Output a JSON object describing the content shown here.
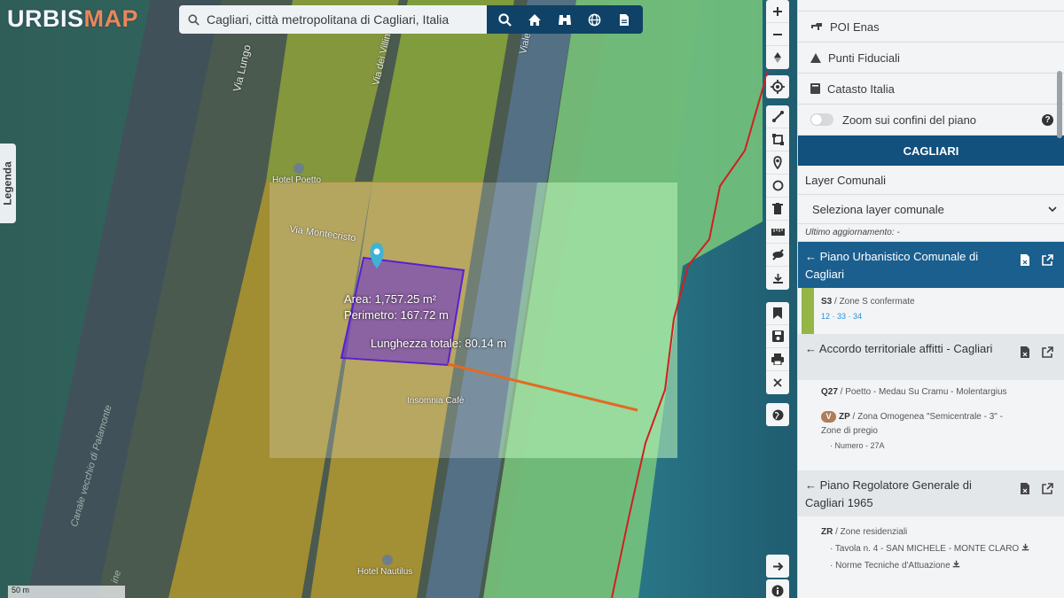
{
  "app": {
    "logo_a": "URBIS",
    "logo_b": "MAP"
  },
  "search": {
    "value": "Cagliari, città metropolitana di Cagliari, Italia",
    "icons": [
      "search-icon",
      "home-icon",
      "binoculars-icon",
      "globe-icon",
      "document-icon"
    ]
  },
  "legend_tab": {
    "label": "Legenda"
  },
  "map": {
    "street_labels": [
      "Via Lungo",
      "Via dei Villini",
      "Viale Po",
      "Via Montecristo"
    ],
    "poi_labels": [
      "Hotel Poetto",
      "Insomnia Cafè",
      "Hotel Nautilus"
    ],
    "faint_labels": [
      "Canale vecchio di Palamonte",
      "ine"
    ],
    "measure": {
      "area": "Area: 1,757.25 m²",
      "perimeter": "Perimetro: 167.72 m",
      "length": "Lunghezza totale: 80.14 m"
    },
    "scale": "50 m",
    "colors": {
      "yellow_zone": "#c9a52a",
      "green_zone": "#8cd383",
      "olive_zone": "#94b63d",
      "blue_zone": "#5d7fa8",
      "measure_poly": "#6a2cd8",
      "measure_line": "#e26a22",
      "coast_line": "#d11f1f"
    }
  },
  "toolbar": {
    "group1": [
      "zoom-in-icon",
      "zoom-out-icon",
      "compass-icon"
    ],
    "group2": [
      "locate-icon"
    ],
    "group3": [
      "measure-line-icon",
      "measure-area-icon",
      "marker-icon",
      "circle-icon",
      "trash-icon",
      "ruler-icon",
      "hide-icon",
      "download-icon"
    ],
    "group4": [
      "bookmark-icon",
      "save-icon",
      "print-icon",
      "close-icon"
    ],
    "group5": [
      "world-icon"
    ],
    "group6": [
      "arrow-right-icon"
    ],
    "group7": [
      "info-icon"
    ]
  },
  "panel": {
    "row_poi": "POI Enas",
    "row_fiduciali": "Punti Fiduciali",
    "row_catasto": "Catasto Italia",
    "row_zoom": "Zoom sui confini del piano",
    "city": "CAGLIARI",
    "layer_label": "Layer Comunali",
    "layer_select": "Seleziona layer comunale",
    "updated": "Ultimo aggiornamento: -",
    "plans": [
      {
        "title": "← Piano Urbanistico Comunale di Cagliari",
        "zone_code": "S3",
        "zone_desc": " / Zone S confermate",
        "zone_links": "12 · 33 · 34"
      },
      {
        "title": "← Accordo territoriale affitti - Cagliari",
        "zone_code": "Q27",
        "zone_desc": " / Poetto - Medau Su Cramu - Molentargius",
        "badge": "V",
        "zone2_code": "ZP",
        "zone2_desc": " / Zona Omogenea \"Semicentrale - 3\" -",
        "zone2_sub": "Zone di pregio",
        "zone2_num": "· Numero - 27A"
      },
      {
        "title": "← Piano Regolatore Generale di Cagliari 1965",
        "zone_code": "ZR",
        "zone_desc": " / Zone residenziali",
        "item1": "· Tavola n. 4 - SAN MICHELE - MONTE CLARO",
        "item2": "· Norme Tecniche d'Attuazione"
      }
    ]
  }
}
